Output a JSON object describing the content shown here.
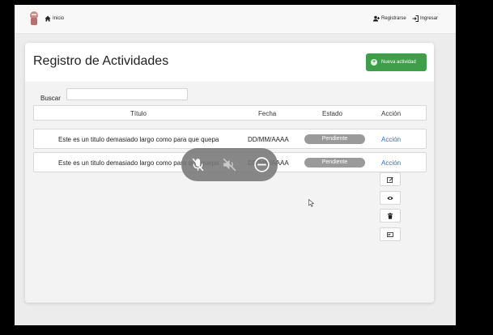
{
  "navbar": {
    "home_label": "Inicio",
    "register_label": "Registrarse",
    "login_label": "Ingresar"
  },
  "page": {
    "title": "Registro de Actividades",
    "new_button_label": "Nueva actividad"
  },
  "search": {
    "label": "Buscar",
    "value": "",
    "placeholder": ""
  },
  "table": {
    "headers": {
      "title": "Título",
      "date": "Fecha",
      "status": "Estado",
      "action": "Acción"
    },
    "rows": [
      {
        "title": "Este es un titulo demasiado largo como para que quepa",
        "date": "DD/MM/AAAA",
        "status": "Pendiente",
        "action": "Acción"
      },
      {
        "title": "Este es un titulo demasiado largo como para que quepa",
        "date": "DD/MM/AAAA",
        "status": "Pendiente",
        "action": "Acción"
      }
    ]
  },
  "action_menu": {
    "icons": [
      "edit-icon",
      "eye-icon",
      "trash-icon",
      "card-icon"
    ]
  },
  "overlay": {
    "icons": [
      "mic-off-icon",
      "speaker-off-icon",
      "minus-circle-icon"
    ]
  },
  "colors": {
    "accent_green": "#3f9e49",
    "badge_gray": "#9a9a9a",
    "link_blue": "#2a6dd6",
    "overlay_gray": "#767676"
  }
}
